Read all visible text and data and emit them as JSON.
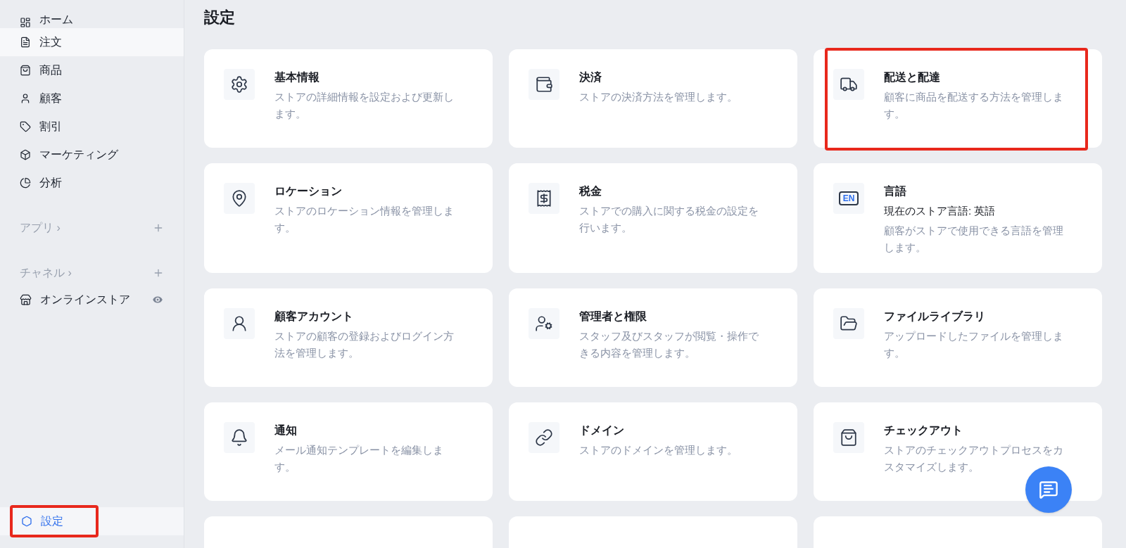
{
  "sidebar": {
    "items": [
      {
        "label": "ホーム",
        "selected": false,
        "hovered": false
      },
      {
        "label": "注文",
        "selected": false,
        "hovered": true
      },
      {
        "label": "商品",
        "selected": false,
        "hovered": false
      },
      {
        "label": "顧客",
        "selected": false,
        "hovered": false
      },
      {
        "label": "割引",
        "selected": false,
        "hovered": false
      },
      {
        "label": "マーケティング",
        "selected": false,
        "hovered": false
      },
      {
        "label": "分析",
        "selected": false,
        "hovered": false
      }
    ],
    "sections": [
      {
        "label": "アプリ ›"
      },
      {
        "label": "チャネル ›",
        "items": [
          {
            "label": "オンラインストア"
          }
        ]
      }
    ],
    "footer_item": {
      "label": "設定",
      "selected": true,
      "highlighted": true
    }
  },
  "page": {
    "title": "設定"
  },
  "cards": [
    {
      "kind": "setting",
      "title": "基本情報",
      "description": "ストアの詳細情報を設定および更新します。",
      "highlighted": false
    },
    {
      "kind": "setting",
      "title": "決済",
      "description": "ストアの決済方法を管理します。",
      "highlighted": false
    },
    {
      "kind": "setting",
      "title": "配送と配達",
      "description": "顧客に商品を配送する方法を管理します。",
      "highlighted": true
    },
    {
      "kind": "setting",
      "title": "ロケーション",
      "description": "ストアのロケーション情報を管理します。",
      "highlighted": false
    },
    {
      "kind": "setting",
      "title": "税金",
      "description": "ストアでの購入に関する税金の設定を行います。",
      "highlighted": false
    },
    {
      "kind": "setting",
      "title": "言語",
      "status": "現在のストア言語: 英語",
      "icon_text": "EN",
      "description": "顧客がストアで使用できる言語を管理します。",
      "highlighted": false
    },
    {
      "kind": "setting",
      "title": "顧客アカウント",
      "description": "ストアの顧客の登録およびログイン方法を管理します。",
      "highlighted": false
    },
    {
      "kind": "setting",
      "title": "管理者と権限",
      "description": "スタッフ及びスタッフが閲覧・操作できる内容を管理します。",
      "highlighted": false
    },
    {
      "kind": "setting",
      "title": "ファイルライブラリ",
      "description": "アップロードしたファイルを管理します。",
      "highlighted": false
    },
    {
      "kind": "setting",
      "title": "通知",
      "description": "メール通知テンプレートを編集します。",
      "highlighted": false
    },
    {
      "kind": "setting",
      "title": "ドメイン",
      "description": "ストアのドメインを管理します。",
      "highlighted": false
    },
    {
      "kind": "setting",
      "title": "チェックアウト",
      "description": "ストアのチェックアウトプロセスをカスタマイズします。",
      "highlighted": false
    },
    {
      "kind": "cut",
      "highlighted": false
    },
    {
      "kind": "cut",
      "highlighted": false
    },
    {
      "kind": "cut",
      "highlighted": false
    }
  ]
}
